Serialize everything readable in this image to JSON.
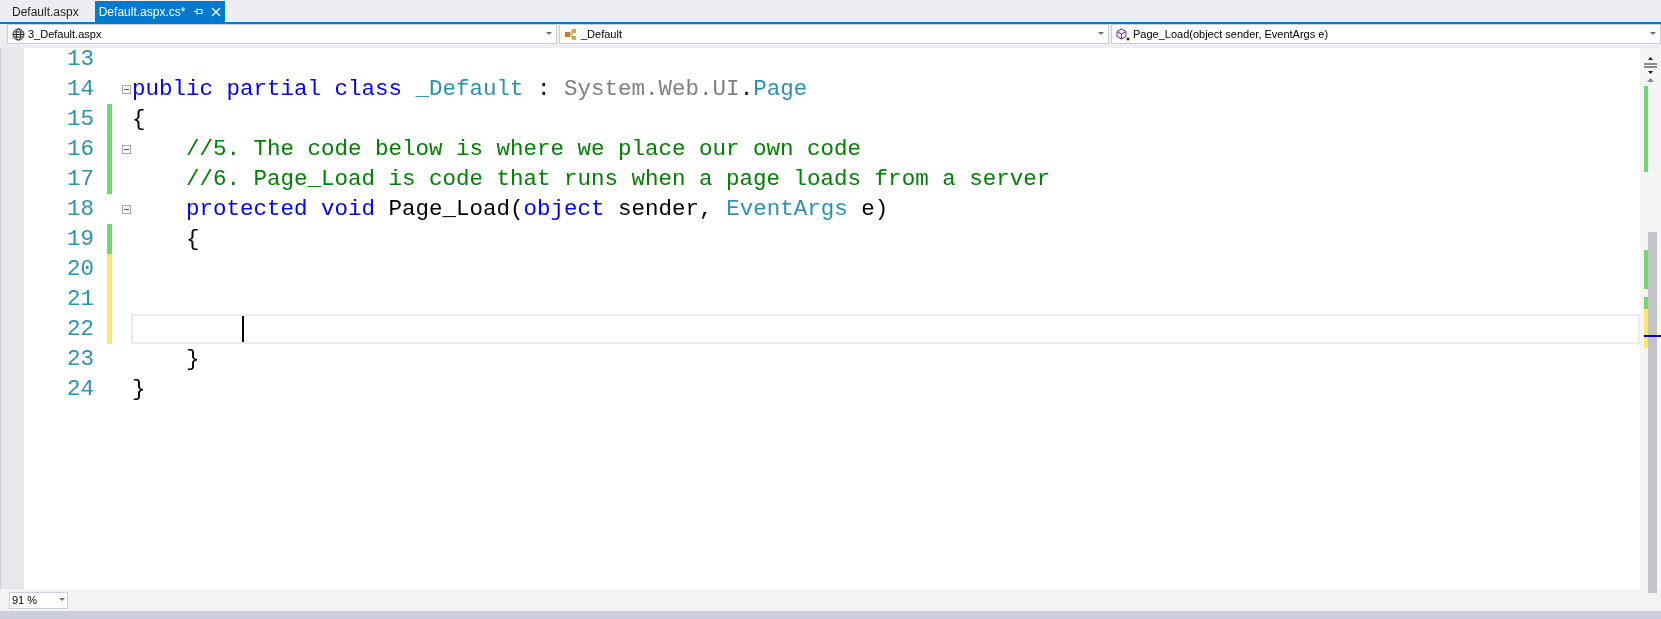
{
  "tabs": [
    {
      "label": "Default.aspx",
      "selected": false
    },
    {
      "label": "Default.aspx.cs*",
      "selected": true
    }
  ],
  "navigation_bar": [
    {
      "kind": "project",
      "label": "3_Default.aspx"
    },
    {
      "kind": "class",
      "label": "_Default"
    },
    {
      "kind": "method",
      "label": "Page_Load(object sender, EventArgs e)"
    }
  ],
  "editor": {
    "lines": [
      {
        "number": "13"
      },
      {
        "number": "14",
        "foldable": true,
        "tokens": [
          {
            "kind": "keyword",
            "text": "public partial class "
          },
          {
            "kind": "type",
            "text": "_Default"
          },
          {
            "kind": "plain",
            "text": " : "
          },
          {
            "kind": "namespace",
            "text": "System.Web.UI"
          },
          {
            "kind": "plain",
            "text": "."
          },
          {
            "kind": "type",
            "text": "Page"
          }
        ]
      },
      {
        "number": "15",
        "color": "#6bdb6b",
        "tokens": [
          {
            "kind": "plain",
            "text": "{"
          }
        ]
      },
      {
        "number": "16",
        "color": "#6bdb6b",
        "foldable": true,
        "tokens": [
          {
            "kind": "comment",
            "text": "    //5. The code below is where we place our own code"
          }
        ]
      },
      {
        "number": "17",
        "color": "#6bdb6b",
        "tokens": [
          {
            "kind": "comment",
            "text": "    //6. Page_Load is code that runs when a page loads from a server"
          }
        ]
      },
      {
        "number": "18",
        "foldable": true,
        "tokens": [
          {
            "kind": "keyword",
            "text": "    protected void "
          },
          {
            "kind": "plain",
            "text": "Page_Load("
          },
          {
            "kind": "keyword",
            "text": "object"
          },
          {
            "kind": "plain",
            "text": " sender, "
          },
          {
            "kind": "type",
            "text": "EventArgs"
          },
          {
            "kind": "plain",
            "text": " e)"
          }
        ]
      },
      {
        "number": "19",
        "color": "#6bdb6b",
        "tokens": [
          {
            "kind": "plain",
            "text": "    {"
          }
        ]
      },
      {
        "number": "20",
        "color": "#ffe663"
      },
      {
        "number": "21",
        "color": "#ffe663"
      },
      {
        "number": "22",
        "color": "#ffe663",
        "current": true
      },
      {
        "number": "23",
        "tokens": [
          {
            "kind": "plain",
            "text": "    }"
          }
        ]
      },
      {
        "number": "24",
        "tokens": [
          {
            "kind": "plain",
            "text": "}"
          }
        ]
      }
    ]
  },
  "zoom": {
    "value": "91 %"
  }
}
